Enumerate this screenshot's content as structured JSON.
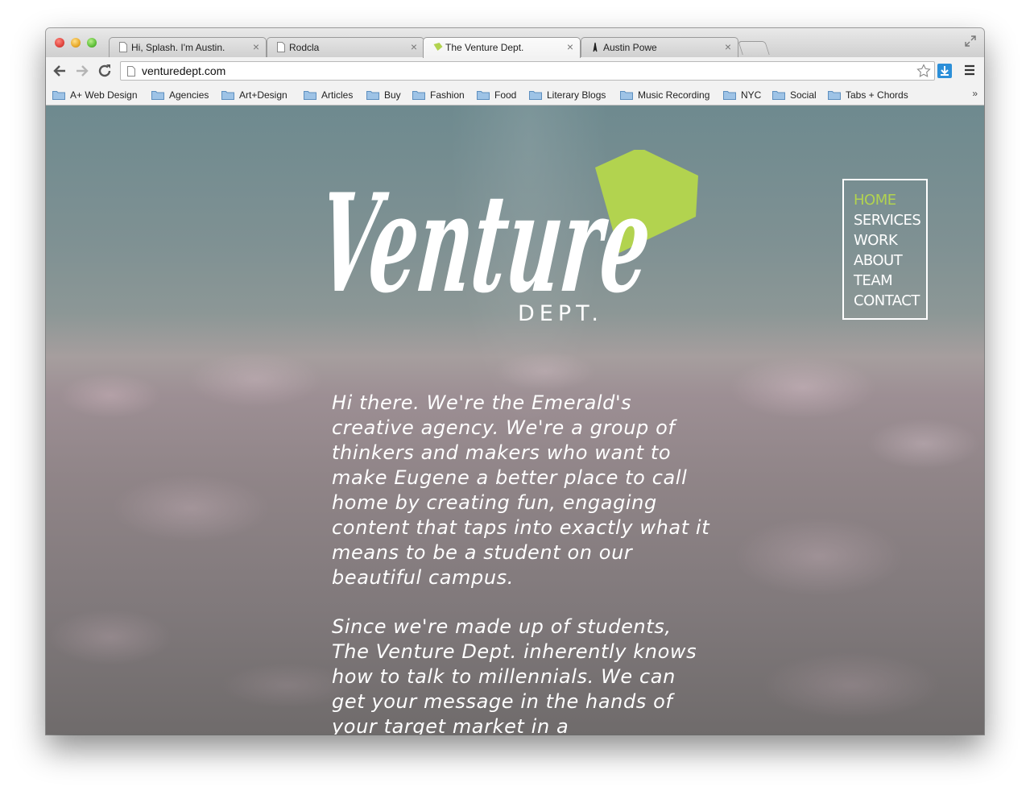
{
  "browser": {
    "tabs": [
      {
        "title": "Hi, Splash. I'm Austin.",
        "active": false
      },
      {
        "title": "Rodcla",
        "active": false
      },
      {
        "title": "The Venture Dept.",
        "active": true
      },
      {
        "title": "Austin Powe",
        "active": false
      }
    ],
    "url": "venturedept.com",
    "bookmarks": [
      "A+ Web Design",
      "Agencies",
      "Art+Design",
      "Articles",
      "Buy",
      "Fashion",
      "Food",
      "Literary Blogs",
      "Music Recording",
      "NYC",
      "Social",
      "Tabs + Chords"
    ],
    "bookmarks_overflow": "»"
  },
  "site": {
    "logo_wordmark": "Venture",
    "logo_subtitle": "DEPT.",
    "brand_color": "#b2d34f",
    "nav": [
      "HOME",
      "SERVICES",
      "WORK",
      "ABOUT",
      "TEAM",
      "CONTACT"
    ],
    "nav_active": "HOME",
    "intro_paragraphs": [
      "Hi there. We're the Emerald's creative agency. We're a group of thinkers and makers who want to make Eugene a better place to call home by creating fun, engaging content that taps into exactly what it means to be a student on our beautiful campus.",
      "Since we're made up of students, The Venture Dept. inherently knows how to talk to millennials. We can get your message in the hands of your target market in a"
    ]
  }
}
